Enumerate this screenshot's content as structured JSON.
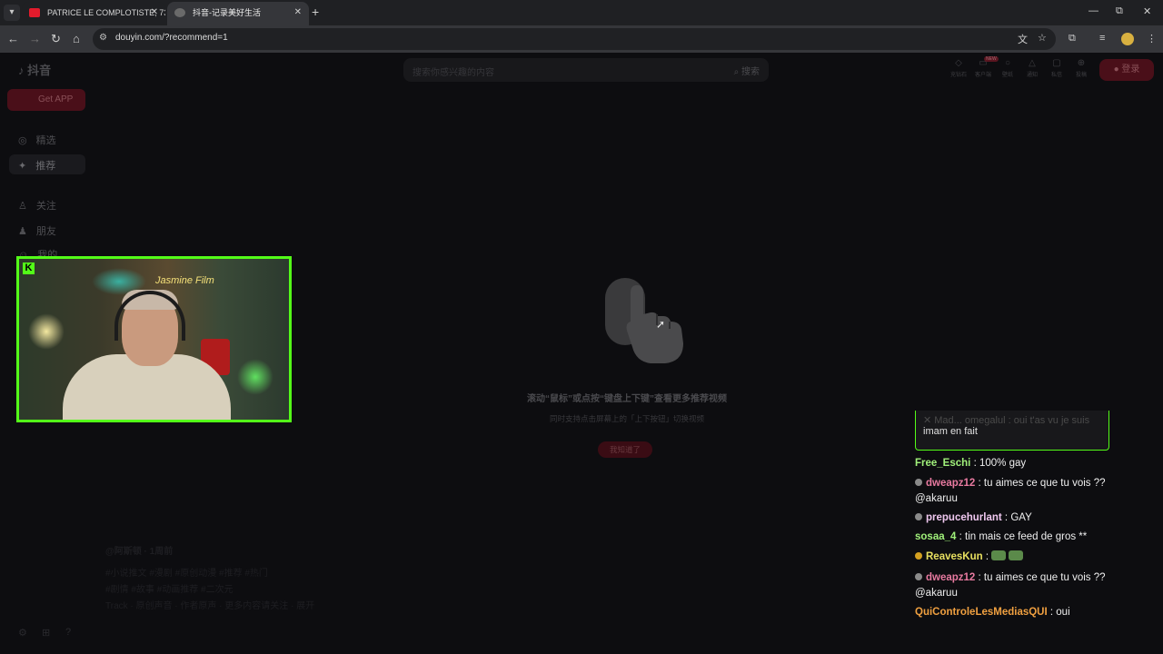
{
  "browser": {
    "tabs": [
      {
        "title": "PATRICE LE COMPLOTISTE, 73 A",
        "favicon_color": "#e21b2c",
        "active": false
      },
      {
        "title": "抖音-记录美好生活",
        "favicon_color": "#9a9a9a",
        "active": true
      }
    ],
    "new_tab_symbol": "+",
    "tab_close_symbol": "✕",
    "url": "douyin.com/?recommend=1",
    "window_controls": [
      "—",
      "⧉",
      "✕"
    ]
  },
  "douyin": {
    "logo_text": "抖音",
    "get_app_label": "Get APP",
    "sidebar": [
      {
        "label": "精选",
        "icon": "compass-icon"
      },
      {
        "label": "推荐",
        "icon": "sparkle-icon",
        "active": true
      },
      {
        "label": "关注",
        "icon": "user-follow-icon"
      },
      {
        "label": "朋友",
        "icon": "friends-icon"
      },
      {
        "label": "我的",
        "icon": "profile-icon"
      }
    ],
    "search_placeholder": "搜索你感兴趣的内容",
    "search_button": "搜索",
    "top_icons": [
      {
        "icon": "shield-icon",
        "label": "充钻石"
      },
      {
        "icon": "pc-icon",
        "label": "客户端"
      },
      {
        "icon": "bulb-icon",
        "label": "壁纸"
      },
      {
        "icon": "bell-icon",
        "label": "通知"
      },
      {
        "icon": "message-icon",
        "label": "私信"
      },
      {
        "icon": "plus-icon",
        "label": "投稿"
      }
    ],
    "new_badge": "NEW",
    "login_label": "登录",
    "hint_main": "滚动“鼠标”或点按“键盘上下键”查看更多推荐视频",
    "hint_sub": "同时支持点击屏幕上的「上下按钮」切换视频",
    "got_it_label": "我知道了",
    "bg_author": "@阿斯顿 · 1周前",
    "bg_caption_1": "#小说推文 #漫剧 #原创动漫 #推荐 #热门",
    "bg_caption_2": "#剧情 #故事 #动画推荐 #二次元",
    "bg_caption_3": "Track · 原创声音 · 作者原声 · 更多内容请关注 · 展开"
  },
  "webcam": {
    "platform_badge": "K",
    "neon_sign": "Jasmine Film",
    "border_color": "#53fc18"
  },
  "chat": {
    "pinned_partial": "✕ Mad... omegalul : oui t'as vu je suis",
    "pinned_text": "imam en fait",
    "messages": [
      {
        "user": "Free_Eschi",
        "color": "#a0f07a",
        "badge": "",
        "text": "100% gay"
      },
      {
        "user": "dweapz12",
        "color": "#e87aa0",
        "badge": "gray",
        "text": "tu aimes ce que tu vois ?? @akaruu"
      },
      {
        "user": "prepucehurlant",
        "color": "#f0c8f0",
        "badge": "gray",
        "text": "GAY"
      },
      {
        "user": "sosaa_4",
        "color": "#a0f07a",
        "badge": "",
        "text": "tin mais ce feed de gros **"
      },
      {
        "user": "ReavesKun",
        "color": "#e8e060",
        "badge": "gold",
        "text": "",
        "emotes": 2
      },
      {
        "user": "dweapz12",
        "color": "#e87aa0",
        "badge": "gray",
        "text": "tu aimes ce que tu vois ?? @akaruu"
      },
      {
        "user": "QuiControleLesMediasQUI",
        "color": "#f0a040",
        "badge": "",
        "text": "oui"
      }
    ]
  }
}
